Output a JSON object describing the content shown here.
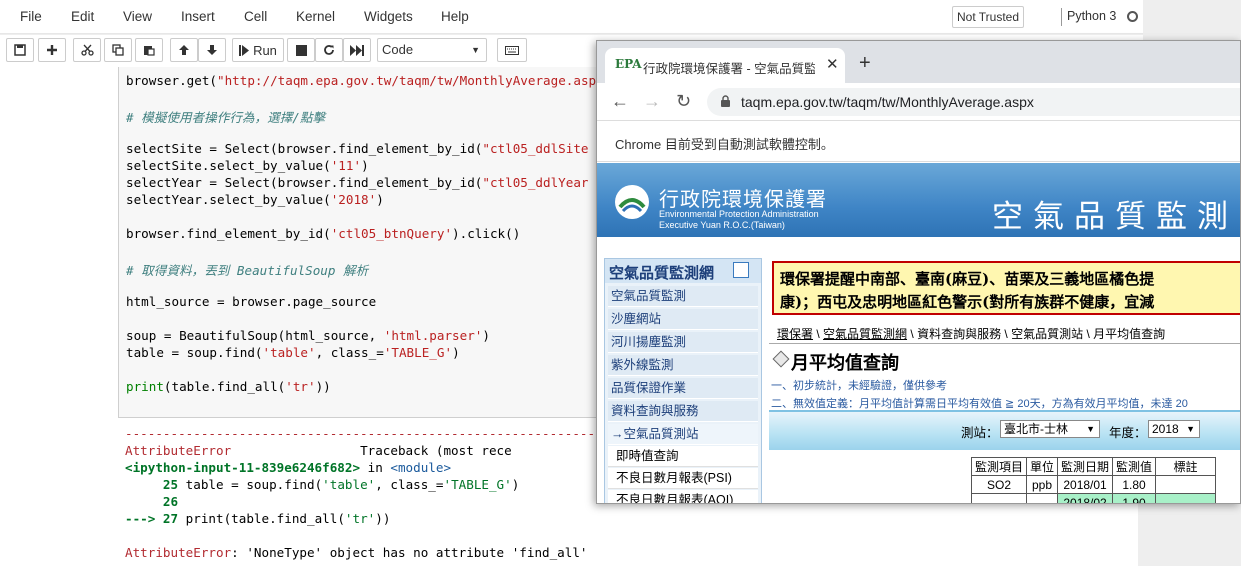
{
  "menubar": {
    "items": [
      "File",
      "Edit",
      "View",
      "Insert",
      "Cell",
      "Kernel",
      "Widgets",
      "Help"
    ],
    "trust_status": "Not Trusted",
    "kernel": "Python 3"
  },
  "toolbar": {
    "run_label": "Run",
    "cell_type": "Code"
  },
  "code": {
    "lines": [
      "browser.get(\"http://taqm.epa.gov.tw/taqm/tw/MonthlyAverage.aspx",
      "",
      "# 模擬使用者操作行為，選擇/點擊",
      "",
      "selectSite = Select(browser.find_element_by_id(\"ctl05_ddlSite",
      "selectSite.select_by_value('11')",
      "selectYear = Select(browser.find_element_by_id(\"ctl05_ddlYear",
      "selectYear.select_by_value('2018')",
      "",
      "browser.find_element_by_id('ctl05_btnQuery').click()",
      "",
      "# 取得資料，丟到 BeautifulSoup 解析",
      "",
      "html_source = browser.page_source",
      "",
      "soup = BeautifulSoup(html_source, 'html.parser')",
      "table = soup.find('table', class_='TABLE_G')",
      "",
      "print(table.find_all('tr'))"
    ]
  },
  "output": {
    "rule": "----------------------------------------------------------------",
    "error_name": "AttributeError",
    "traceback_label": "Traceback (most rece",
    "input_ref": "<ipython-input-11-839e6246f682>",
    "in_word": " in ",
    "module_ref": "<module>",
    "line25_num": "     25 ",
    "line25_code": "table = soup.find('table', class_='TABLE_G')",
    "line26_num": "     26",
    "line27_arrow": "---> 27 ",
    "line27_code": "print(table.find_all('tr'))",
    "error_message": ": 'NoneType' object has no attribute 'find_all'"
  },
  "chrome": {
    "tab_icon": "EPA",
    "tab_title": "行政院環境保護署 - 空氣品質監測網",
    "url": "taqm.epa.gov.tw/taqm/tw/MonthlyAverage.aspx",
    "automation_notice": "Chrome 目前受到自動測試軟體控制。"
  },
  "epa": {
    "org_zh": "行政院環境保護署",
    "org_en_1": "Environmental Protection Administration",
    "org_en_2": "Executive Yuan R.O.C.(Taiwan)",
    "site_title": "空氣品質監測",
    "sidebar_title": "空氣品質監測網",
    "sidebar_items": [
      "空氣品質監測",
      "沙塵網站",
      "河川揚塵監測",
      "紫外線監測",
      "品質保證作業",
      "資料查詢與服務",
      "→空氣品質測站"
    ],
    "sidebar_sub_items": [
      "即時值查詢",
      "不良日數月報表(PSI)",
      "不良日數月報表(AQI)"
    ],
    "marquee_line1": "環保署提醒中南部、臺南(麻豆)、苗栗及三義地區橘色提",
    "marquee_line2": "康)；西屯及忠明地區紅色警示(對所有族群不健康，宜減",
    "breadcrumb": [
      "環保署",
      "空氣品質監測網",
      "資料查詢與服務",
      "空氣品質測站",
      "月平均值查詢"
    ],
    "page_title": "月平均值查詢",
    "note1": "一、初步統計，未經驗證，僅供參考",
    "note2": "二、無效值定義：月平均值計算需日平均有效值 ≧ 20天，方為有效月平均值，未達 20",
    "site_label": "測站：",
    "site_value": "臺北市-士林",
    "year_label": "年度：",
    "year_value": "2018",
    "table_headers": [
      "監測項目",
      "單位",
      "監測日期",
      "監測值",
      "標註"
    ],
    "table_rows": [
      [
        "SO2",
        "ppb",
        "2018/01",
        "1.80",
        ""
      ],
      [
        "",
        "",
        "2018/02",
        "1.90",
        ""
      ]
    ]
  }
}
